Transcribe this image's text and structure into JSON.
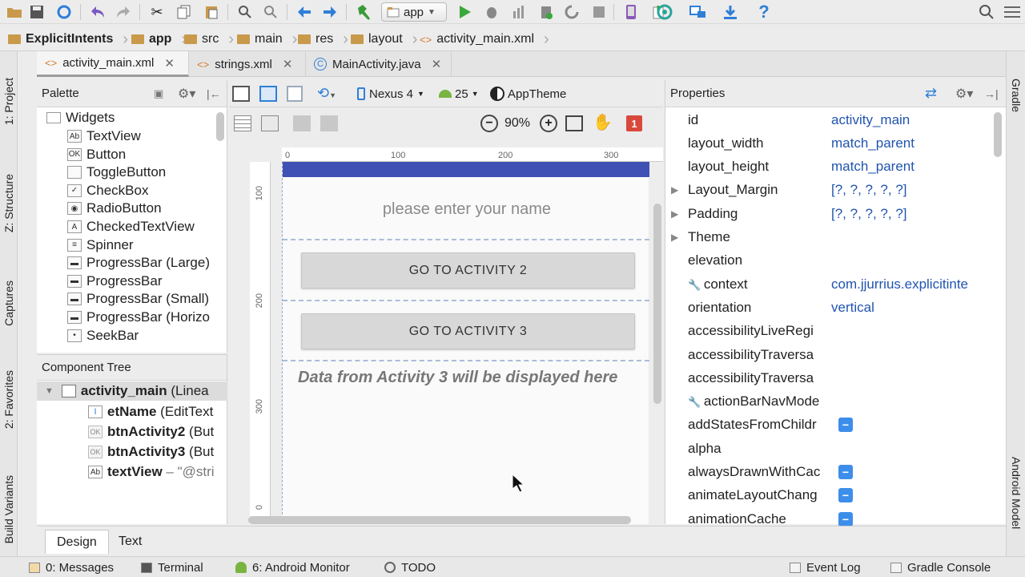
{
  "toolbar": {
    "run_config_label": "app"
  },
  "breadcrumb": [
    "ExplicitIntents",
    "app",
    "src",
    "main",
    "res",
    "layout",
    "activity_main.xml"
  ],
  "editor_tabs": [
    {
      "label": "activity_main.xml",
      "active": true
    },
    {
      "label": "strings.xml",
      "active": false
    },
    {
      "label": "MainActivity.java",
      "active": false
    }
  ],
  "left_strip": [
    "1: Project",
    "Z: Structure",
    "Captures",
    "2: Favorites",
    "Build Variants"
  ],
  "right_strip": [
    "Gradle",
    "Android Model"
  ],
  "palette": {
    "title": "Palette",
    "group": "Widgets",
    "items": [
      {
        "label": "TextView",
        "icon": "Ab"
      },
      {
        "label": "Button",
        "icon": "OK"
      },
      {
        "label": "ToggleButton",
        "icon": ""
      },
      {
        "label": "CheckBox",
        "icon": "✓"
      },
      {
        "label": "RadioButton",
        "icon": "◉"
      },
      {
        "label": "CheckedTextView",
        "icon": "A"
      },
      {
        "label": "Spinner",
        "icon": "≡"
      },
      {
        "label": "ProgressBar (Large)",
        "icon": "▬"
      },
      {
        "label": "ProgressBar",
        "icon": "▬"
      },
      {
        "label": "ProgressBar (Small)",
        "icon": "▬"
      },
      {
        "label": "ProgressBar (Horizo",
        "icon": "▬"
      },
      {
        "label": "SeekBar",
        "icon": "•"
      }
    ]
  },
  "component_tree": {
    "title": "Component Tree",
    "rows": [
      {
        "name": "activity_main",
        "type": "(Linea",
        "icon": ""
      },
      {
        "name": "etName",
        "type": "(EditText",
        "icon": "I"
      },
      {
        "name": "btnActivity2",
        "type": "(But",
        "icon": "OK"
      },
      {
        "name": "btnActivity3",
        "type": "(But",
        "icon": "OK"
      },
      {
        "name": "textView",
        "type": "– \"@stri",
        "icon": "Ab"
      }
    ]
  },
  "design_toolbar": {
    "device": "Nexus 4",
    "api": "25",
    "theme": "AppTheme",
    "zoom": "90%",
    "error_count": "1"
  },
  "ruler": {
    "h_labels": [
      "0",
      "100",
      "200",
      "300"
    ],
    "v_labels": [
      "100",
      "200",
      "300",
      "0"
    ]
  },
  "device_preview": {
    "hint": "please enter your name",
    "button1": "GO TO ACTIVITY 2",
    "button2": "GO TO ACTIVITY 3",
    "text": "Data from Activity 3 will be displayed here"
  },
  "properties": {
    "title": "Properties",
    "rows": [
      {
        "name": "id",
        "value": "activity_main"
      },
      {
        "name": "layout_width",
        "value": "match_parent"
      },
      {
        "name": "layout_height",
        "value": "match_parent"
      },
      {
        "name": "Layout_Margin",
        "value": "[?, ?, ?, ?, ?]"
      },
      {
        "name": "Padding",
        "value": "[?, ?, ?, ?, ?]"
      },
      {
        "name": "Theme",
        "value": ""
      },
      {
        "name": "elevation",
        "value": ""
      },
      {
        "name": "context",
        "value": "com.jjurrius.explicitinte"
      },
      {
        "name": "orientation",
        "value": "vertical"
      },
      {
        "name": "accessibilityLiveRegi",
        "value": ""
      },
      {
        "name": "accessibilityTraversa",
        "value": ""
      },
      {
        "name": "accessibilityTraversa",
        "value": ""
      },
      {
        "name": "actionBarNavMode",
        "value": ""
      },
      {
        "name": "addStatesFromChildr",
        "value": ""
      },
      {
        "name": "alpha",
        "value": ""
      },
      {
        "name": "alwaysDrawnWithCac",
        "value": ""
      },
      {
        "name": "animateLayoutChang",
        "value": ""
      },
      {
        "name": "animationCache",
        "value": ""
      }
    ]
  },
  "mode_tabs": [
    "Design",
    "Text"
  ],
  "statusbar": {
    "messages": "0: Messages",
    "terminal": "Terminal",
    "android_monitor": "6: Android Monitor",
    "todo": "TODO",
    "event_log": "Event Log",
    "gradle_console": "Gradle Console"
  }
}
